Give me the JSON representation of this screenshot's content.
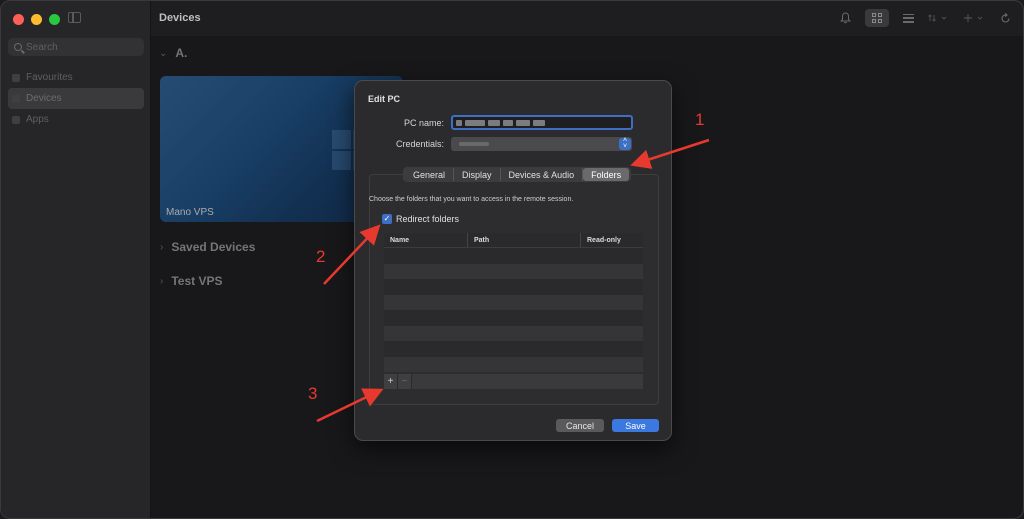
{
  "window": {
    "title": "Devices"
  },
  "sidebar": {
    "search_placeholder": "Search",
    "items": [
      {
        "label": "Favourites",
        "active": false
      },
      {
        "label": "Devices",
        "active": true
      },
      {
        "label": "Apps",
        "active": false
      }
    ]
  },
  "toolbar": {
    "icons": [
      "bell-icon",
      "grid-view-icon",
      "list-view-icon",
      "sort-icon",
      "add-icon",
      "refresh-icon"
    ]
  },
  "main": {
    "groups": [
      {
        "label": "A.",
        "expanded": true
      },
      {
        "label": "Saved Devices",
        "expanded": false
      },
      {
        "label": "Test VPS",
        "expanded": false
      }
    ],
    "tile": {
      "label": "Mano VPS"
    }
  },
  "dialog": {
    "title": "Edit PC",
    "pc_name_label": "PC name:",
    "credentials_label": "Credentials:",
    "tabs": [
      {
        "label": "General",
        "active": false
      },
      {
        "label": "Display",
        "active": false
      },
      {
        "label": "Devices & Audio",
        "active": false
      },
      {
        "label": "Folders",
        "active": true
      }
    ],
    "description": "Choose the folders that you want to access in the remote session.",
    "redirect_label": "Redirect folders",
    "redirect_checked": true,
    "columns": [
      "Name",
      "Path",
      "Read-only"
    ],
    "add_label": "+",
    "remove_label": "−",
    "cancel_label": "Cancel",
    "save_label": "Save"
  },
  "annotations": {
    "accent": "#e8392e",
    "labels": [
      "1",
      "2",
      "3"
    ]
  }
}
